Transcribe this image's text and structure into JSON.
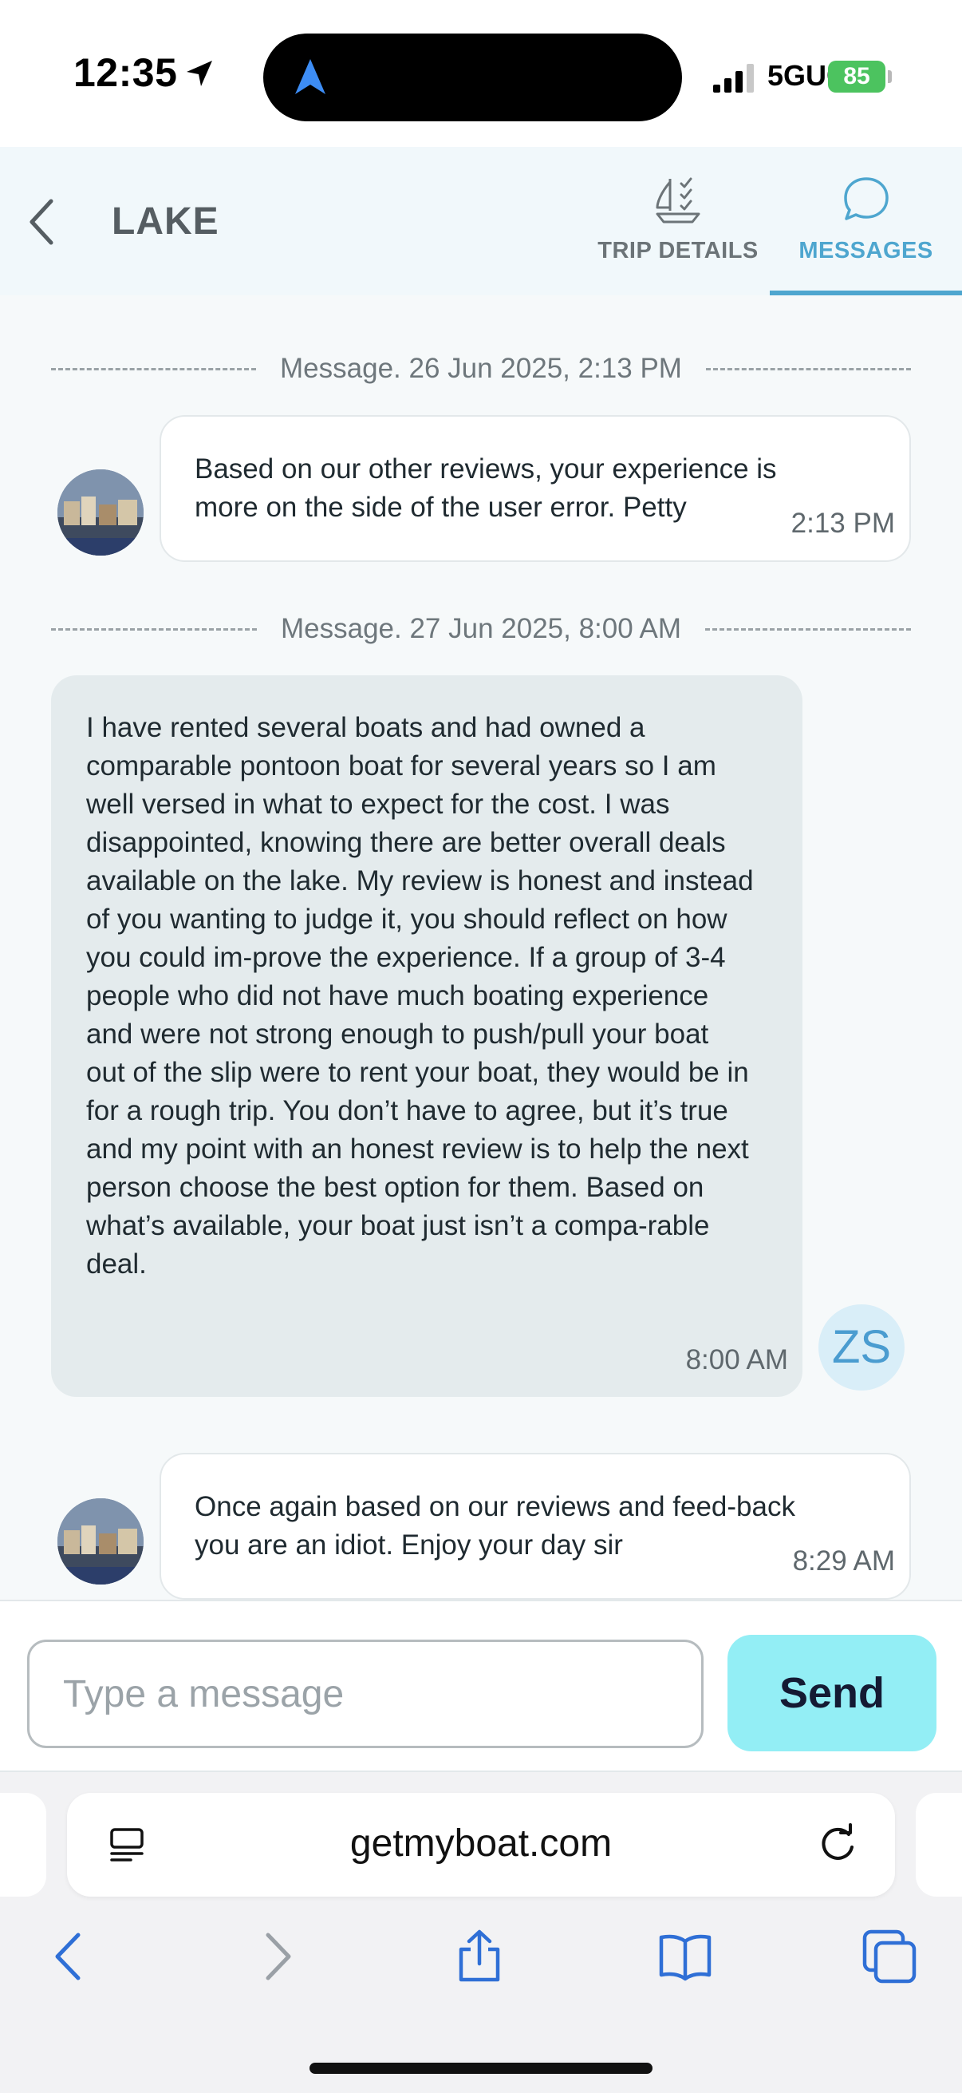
{
  "status_bar": {
    "time": "12:35",
    "network": "5GUC",
    "battery": "85"
  },
  "header": {
    "title": "LAKE",
    "tabs": [
      {
        "label": "TRIP DETAILS",
        "active": false
      },
      {
        "label": "MESSAGES",
        "active": true
      }
    ]
  },
  "messages": [
    {
      "divider": "Message. 26 Jun 2025, 2:13 PM",
      "direction": "incoming",
      "text": "Based on our other reviews, your experience is more on the side of the user error. Petty",
      "time": "2:13 PM"
    },
    {
      "divider": "Message. 27 Jun 2025, 8:00 AM",
      "direction": "outgoing",
      "text": "I have rented several boats and had owned a comparable pontoon boat for several years so I am well versed in what to expect for the cost. I was disappointed, knowing there are better overall deals available on the lake. My review is honest and instead of you wanting to judge it, you should reflect on how you could im-prove the experience. If a group of 3-4 people who did not have much boating experience and were not strong enough to push/pull your boat out of the slip were to rent your boat, they would be in for a rough trip. You don’t have to agree, but it’s true and my point with an honest review is to help the next person choose the best option for them. Based on what’s available, your boat just isn’t a compa-rable deal.",
      "time": "8:00 AM",
      "avatar_initials": "ZS"
    },
    {
      "direction": "incoming",
      "text": "Once again based on our reviews and feed-back you are an idiot. Enjoy your day sir",
      "time": "8:29 AM"
    }
  ],
  "composer": {
    "placeholder": "Type a message",
    "send_label": "Send"
  },
  "browser": {
    "url": "getmyboat.com"
  },
  "colors": {
    "accent": "#4ea6cf",
    "send_button": "#93eef5",
    "outgoing_bubble": "#e4ebed",
    "battery": "#4cc35f"
  }
}
